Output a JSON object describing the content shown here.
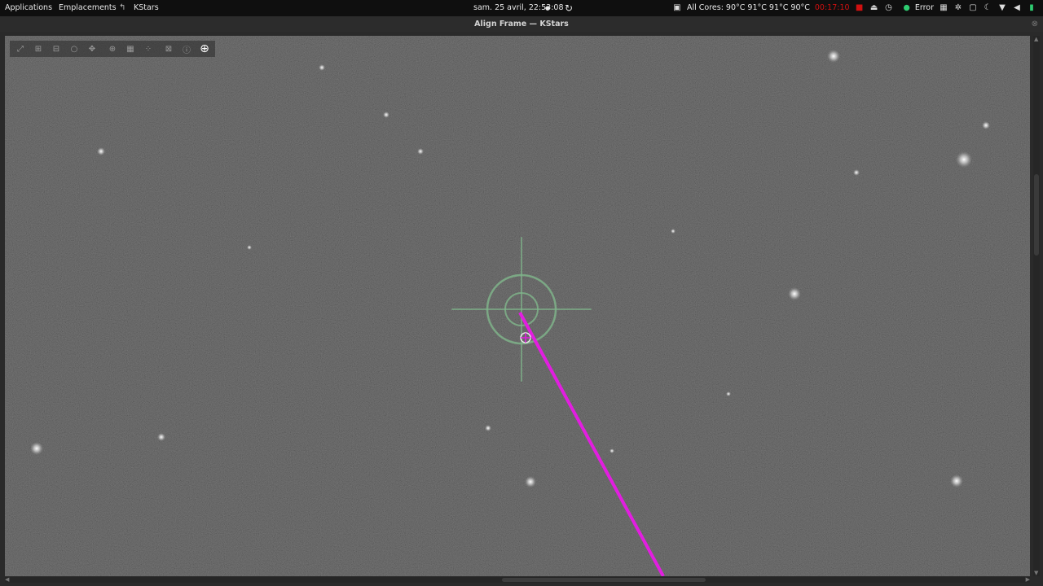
{
  "topbar": {
    "applications": "Applications",
    "places": "Emplacements",
    "app_icon": "kstars-app-icon",
    "app_name": "KStars",
    "clock": "sam. 25 avril, 22:53:08",
    "clock_dot": "●",
    "refresh_icon": "refresh-icon",
    "cpu_temps": "All Cores: 90°C 91°C 91°C 90°C",
    "timer": "00:17:10",
    "error_label": "Error",
    "timer_color": "#d01010",
    "error_dot_color": "#2ecc71"
  },
  "window": {
    "title": "Align Frame — KStars"
  },
  "toolbar": {
    "tools": [
      "zoom-fit-icon",
      "zoom-in-icon",
      "zoom-out-icon",
      "zoom-original-icon",
      "pan-icon",
      "crosshair-icon",
      "grid-icon",
      "stars-icon",
      "object-detect-icon",
      "info-icon",
      "target-icon"
    ]
  },
  "overlay": {
    "crosshair_color": "#7fb38a",
    "guide_line_color": "#e21ee0"
  }
}
